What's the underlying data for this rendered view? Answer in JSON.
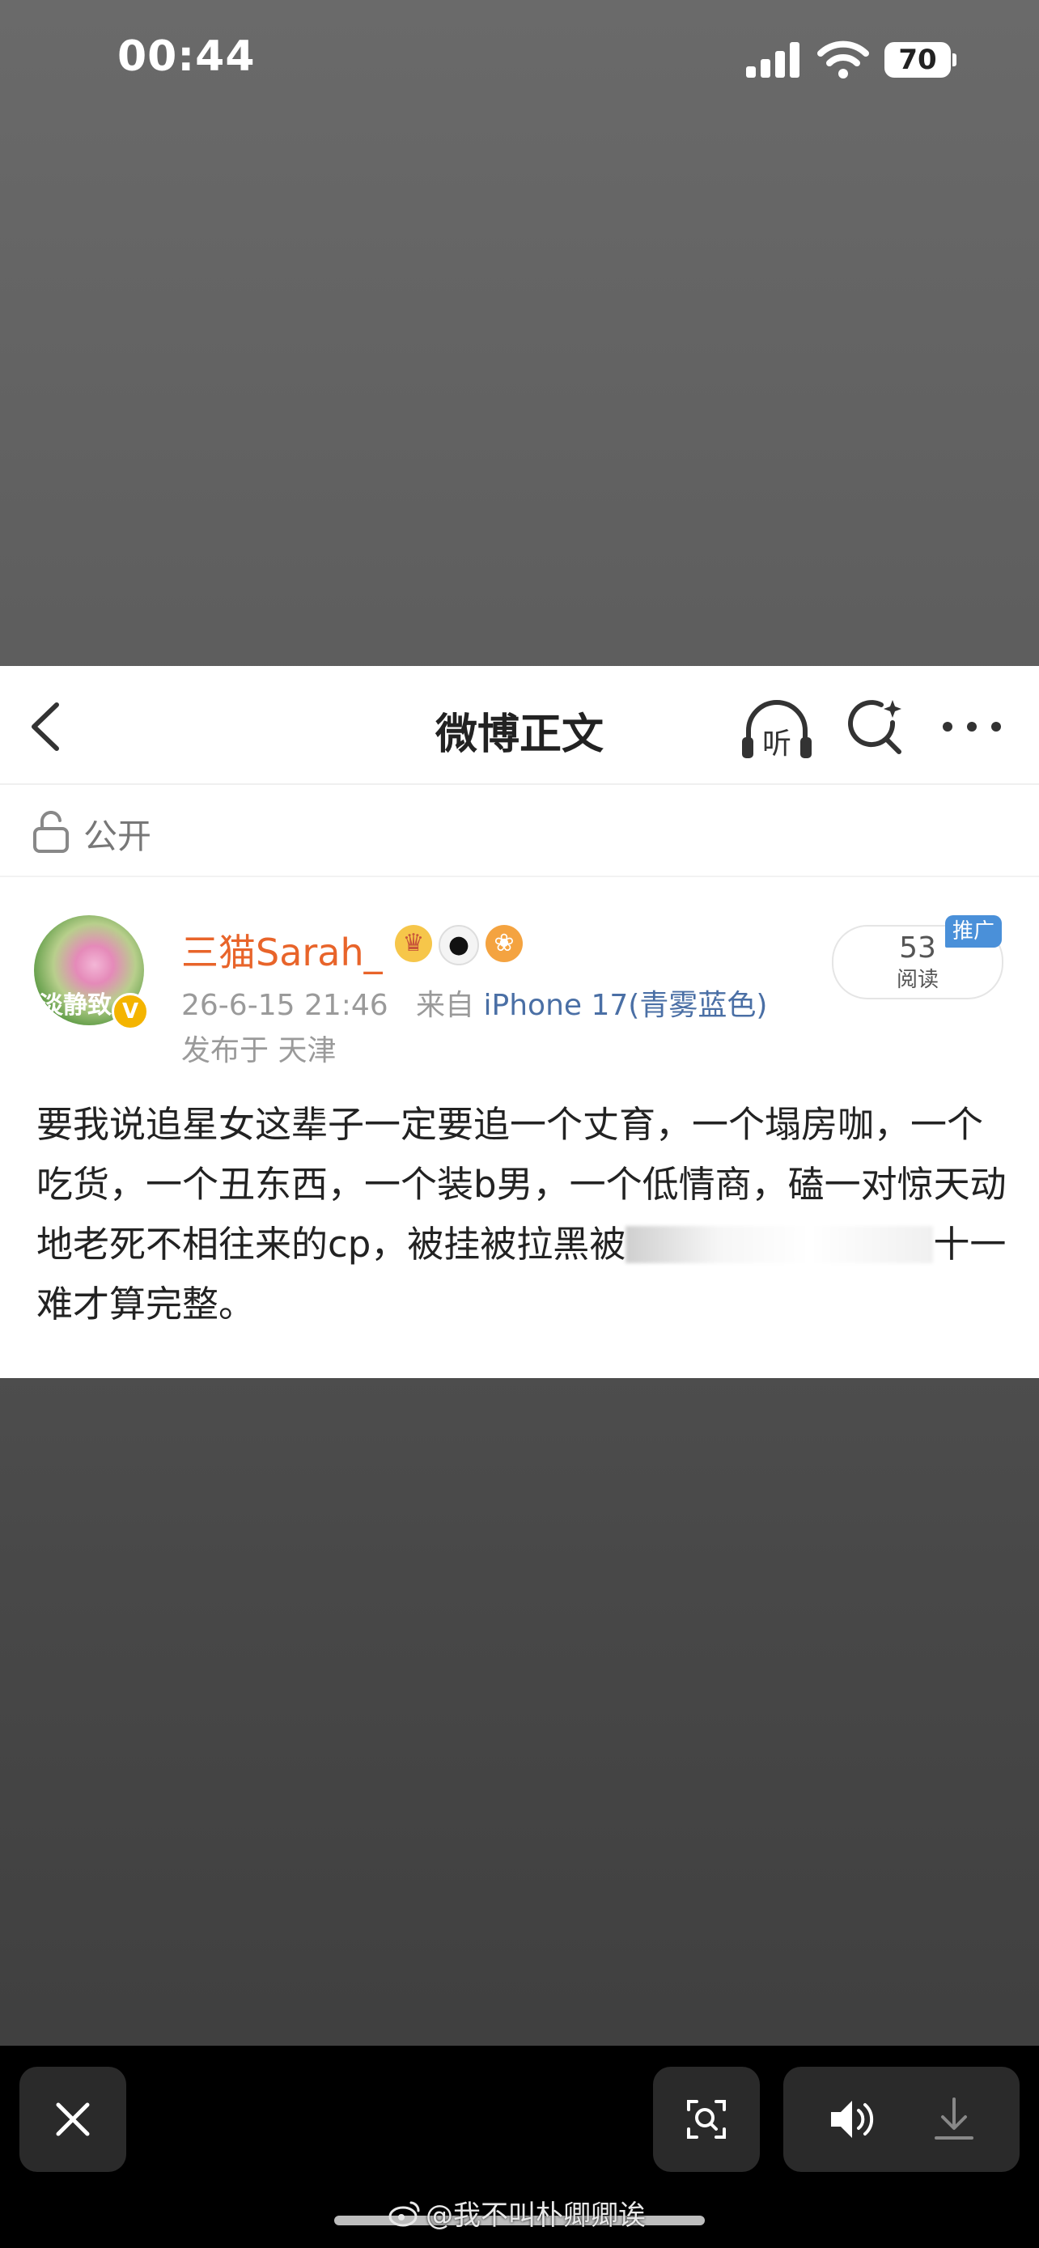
{
  "status_bar": {
    "time": "00:44",
    "battery": "70"
  },
  "nav": {
    "title": "微博正文",
    "listen_glyph": "听"
  },
  "visibility": {
    "label": "公开"
  },
  "post": {
    "author": "三猫Sarah_",
    "avatar_text": "淡静致",
    "date": "26-6-15 21:46",
    "source_prefix": "来自",
    "device": "iPhone 17(青雾蓝色)",
    "location": "发布于 天津",
    "reads_count": "53",
    "reads_label": "阅读",
    "promo_tag": "推广",
    "body_start": "要我说追星女这辈子一定要追一个丈育，一个塌房咖，一个吃货，一个丑东西，一个装b男，一个低情商，磕一对惊天动地老死不相往来的cp，被挂被拉黑",
    "body_hidden_char": "被",
    "body_end": "十一难才算完整。"
  },
  "watermark": {
    "text": "@我不叫朴卿卿诶"
  },
  "colors": {
    "author_orange": "#e8642a",
    "device_blue": "#4a6fa5",
    "promo_blue": "#4a90d9",
    "verified_gold": "#f4b400"
  }
}
